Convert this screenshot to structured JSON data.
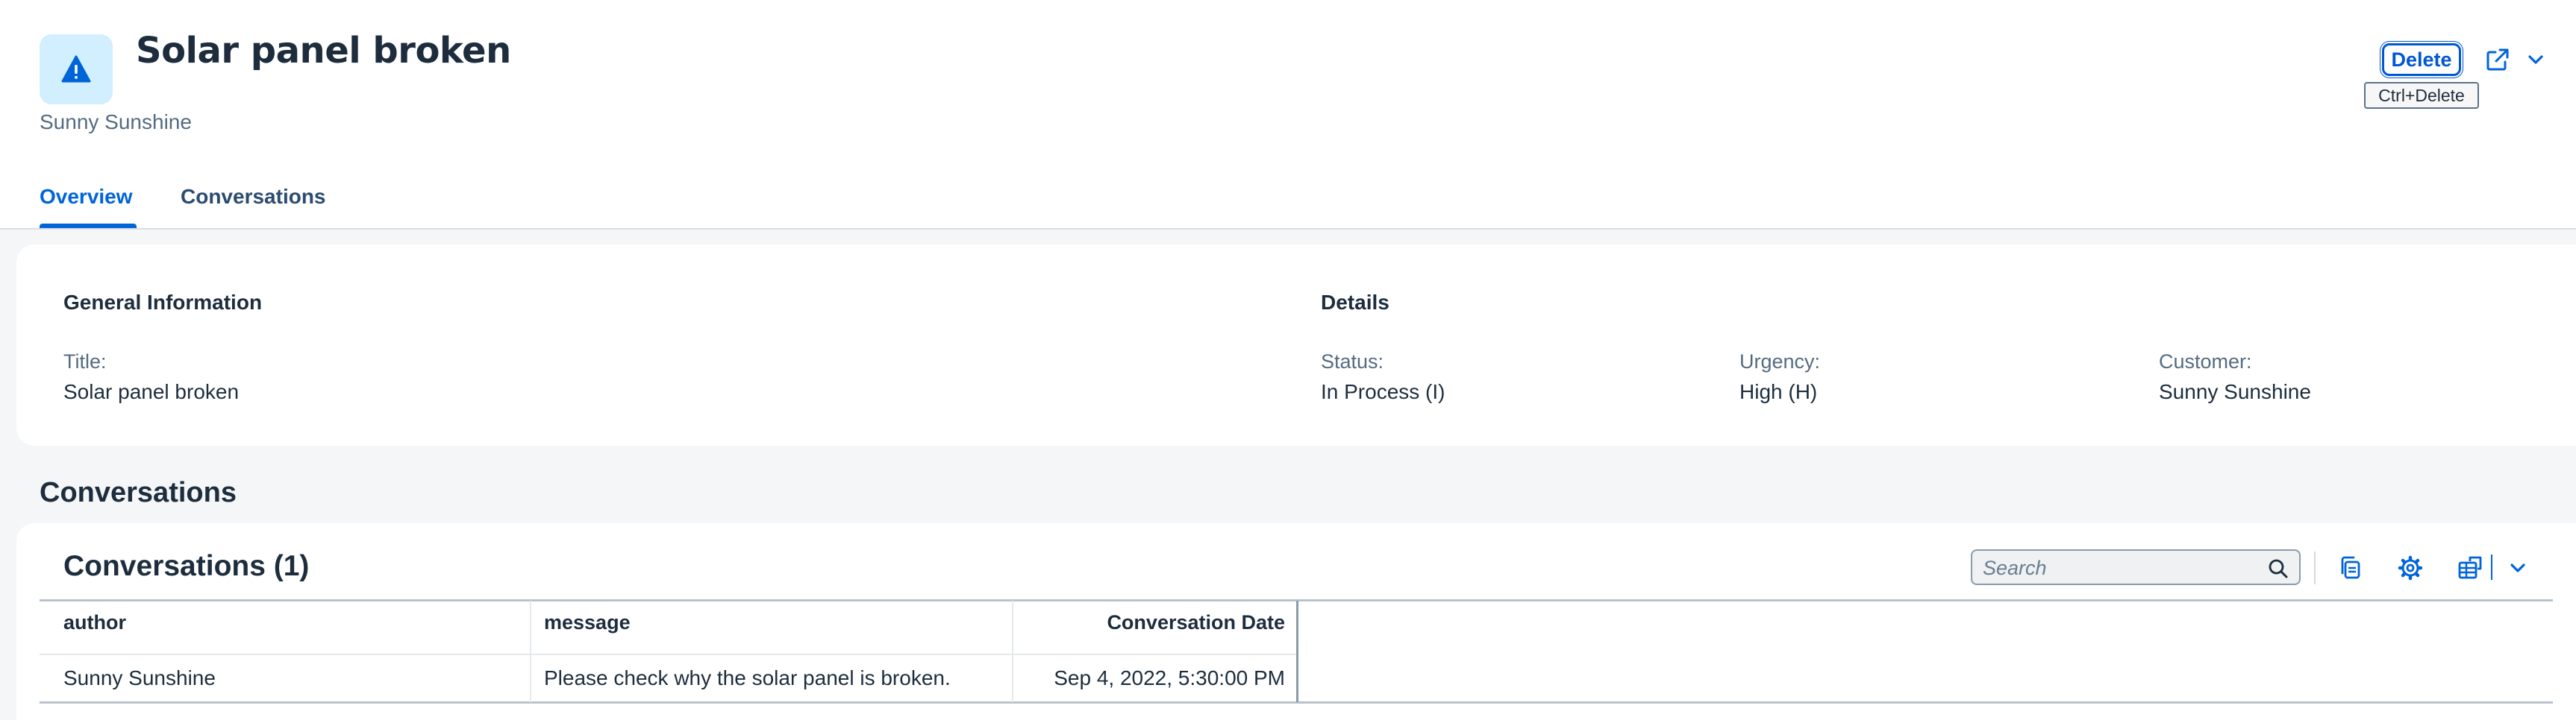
{
  "header": {
    "title": "Solar panel broken",
    "subtitle": "Sunny Sunshine",
    "delete_label": "Delete",
    "delete_tooltip": "Ctrl+Delete",
    "icon": "warning-icon"
  },
  "tabs": [
    {
      "label": "Overview",
      "selected": true
    },
    {
      "label": "Conversations",
      "selected": false
    }
  ],
  "general_information": {
    "heading": "General Information",
    "title_label": "Title:",
    "title_value": "Solar panel broken"
  },
  "details": {
    "heading": "Details",
    "status_label": "Status:",
    "status_value": "In Process (I)",
    "urgency_label": "Urgency:",
    "urgency_value": "High (H)",
    "customer_label": "Customer:",
    "customer_value": "Sunny Sunshine"
  },
  "conversations_section": {
    "heading": "Conversations",
    "table_title": "Conversations (1)",
    "search_placeholder": "Search",
    "columns": [
      "author",
      "message",
      "Conversation Date"
    ],
    "rows": [
      [
        "Sunny Sunshine",
        "Please check why the solar panel is broken.",
        "Sep 4, 2022, 5:30:00 PM"
      ]
    ]
  },
  "colors": {
    "accent": "#0064d9",
    "text": "#1d2d3e",
    "icon_bg": "#d1efff",
    "page_bg": "#f5f6f7"
  }
}
